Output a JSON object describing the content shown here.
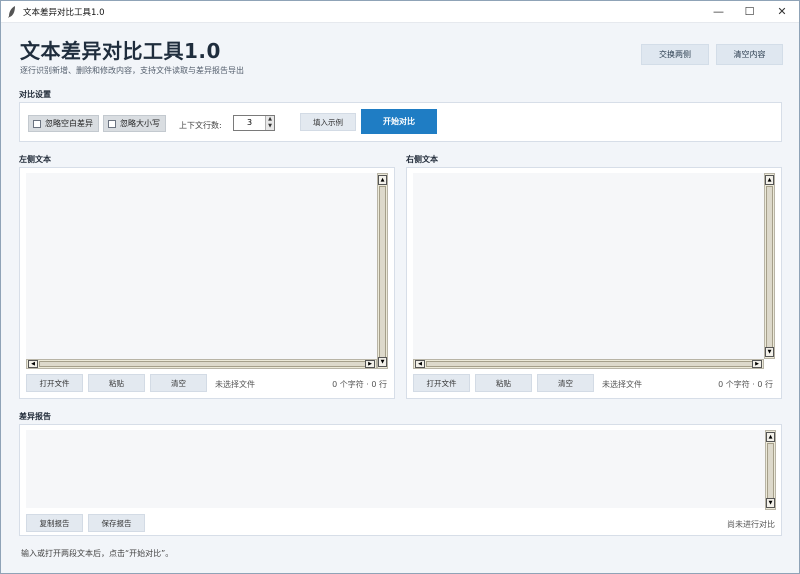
{
  "window": {
    "title": "文本差异对比工具1.0",
    "controls": {
      "minimize": "—",
      "maximize": "☐",
      "close": "✕"
    }
  },
  "header": {
    "title": "文本差异对比工具1.0",
    "subtitle": "逐行识别新增、删除和修改内容，支持文件读取与差异报告导出",
    "swap_label": "交换两侧",
    "clear_label": "清空内容"
  },
  "settings": {
    "section_label": "对比设置",
    "ignore_whitespace_label": "忽略空白差异",
    "ignore_whitespace_checked": false,
    "ignore_case_label": "忽略大小写",
    "ignore_case_checked": false,
    "context_lines_label": "上下文行数:",
    "context_lines_value": "3",
    "fill_sample_label": "填入示例",
    "start_compare_label": "开始对比"
  },
  "left_panel": {
    "section_label": "左侧文本",
    "open_file_label": "打开文件",
    "paste_label": "粘贴",
    "clear_label": "清空",
    "file_status": "未选择文件",
    "count_status": "0 个字符 · 0 行"
  },
  "right_panel": {
    "section_label": "右侧文本",
    "open_file_label": "打开文件",
    "paste_label": "粘贴",
    "clear_label": "清空",
    "file_status": "未选择文件",
    "count_status": "0 个字符 · 0 行"
  },
  "report": {
    "section_label": "差异报告",
    "copy_label": "复制报告",
    "save_label": "保存报告",
    "status": "尚未进行对比"
  },
  "footer": {
    "hint": "输入或打开两段文本后，点击“开始对比”。"
  },
  "colors": {
    "accent": "#1f7dc4",
    "background": "#f2f5f9",
    "panel": "#ffffff",
    "text_area": "#f6f7f9"
  },
  "icons": {
    "app_icon": "feather-icon",
    "scroll_up": "arrow-up-icon",
    "scroll_down": "arrow-down-icon",
    "scroll_left": "arrow-left-icon",
    "scroll_right": "arrow-right-icon"
  }
}
